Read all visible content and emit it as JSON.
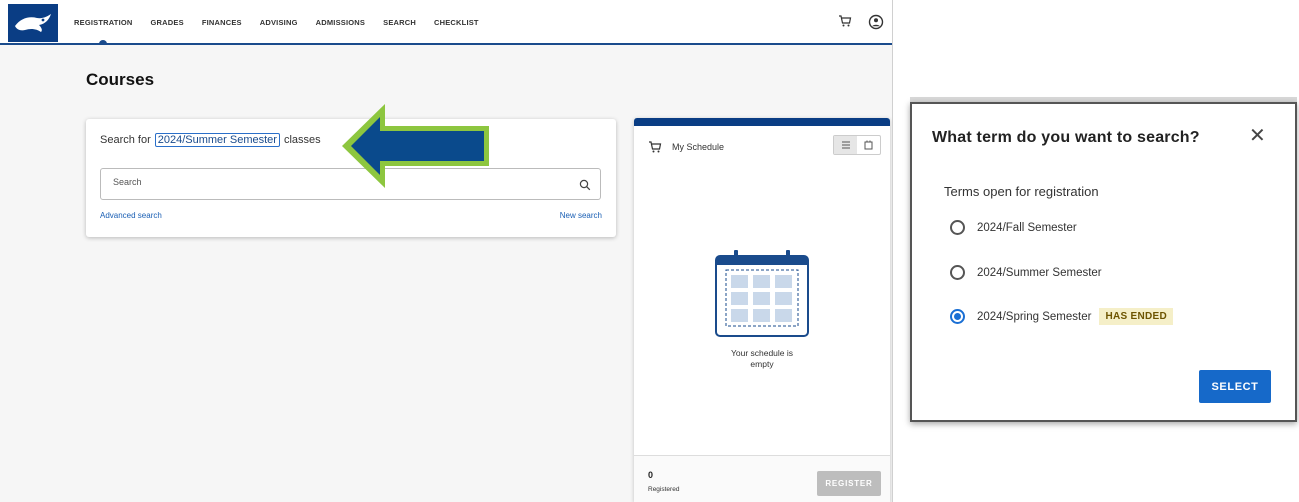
{
  "nav": {
    "items": [
      {
        "label": "REGISTRATION"
      },
      {
        "label": "GRADES"
      },
      {
        "label": "FINANCES"
      },
      {
        "label": "ADVISING"
      },
      {
        "label": "ADMISSIONS"
      },
      {
        "label": "SEARCH"
      },
      {
        "label": "CHECKLIST"
      }
    ],
    "active": "REGISTRATION",
    "logo_icon": "eagle-logo",
    "cart_icon": "cart-icon",
    "user_icon": "user-circle-icon"
  },
  "page": {
    "title": "Courses"
  },
  "search": {
    "prefix": "Search for",
    "term": "2024/Summer Semester",
    "suffix": "classes",
    "placeholder": "Search",
    "advanced_link": "Advanced search",
    "new_link": "New search"
  },
  "schedule": {
    "title": "My Schedule",
    "empty_text": "Your schedule is empty",
    "registered_count": "0",
    "registered_label": "Registered",
    "register_button": "REGISTER"
  },
  "dialog": {
    "title": "What term do you want to search?",
    "subtitle": "Terms open for registration",
    "options": [
      {
        "label": "2024/Fall Semester",
        "selected": false
      },
      {
        "label": "2024/Summer Semester",
        "selected": false
      },
      {
        "label": "2024/Spring Semester",
        "selected": true,
        "badge": "HAS ENDED"
      }
    ],
    "select_button": "SELECT"
  },
  "colors": {
    "brand": "#0a3d84",
    "link": "#1a5fb4",
    "accent": "#1669c9",
    "arrow_fill": "#0a4a8c",
    "arrow_border": "#8dc63f",
    "badge_bg": "#f5efc8"
  }
}
